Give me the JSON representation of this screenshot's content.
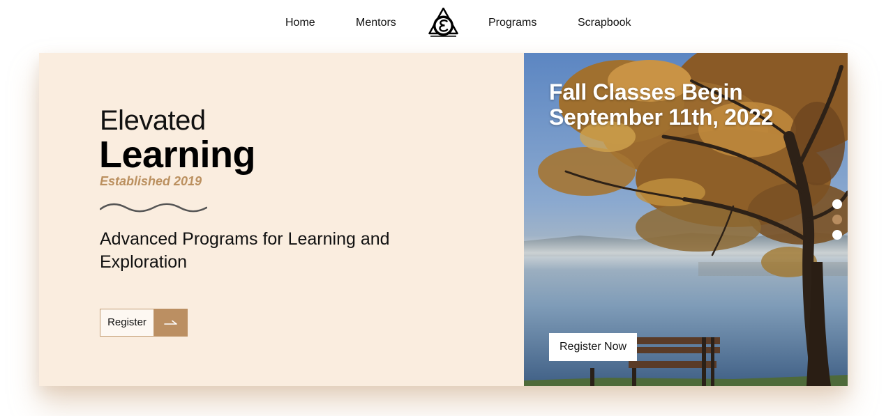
{
  "nav": {
    "items": [
      {
        "label": "Home"
      },
      {
        "label": "Mentors"
      },
      {
        "label": "Programs"
      },
      {
        "label": "Scrapbook"
      }
    ],
    "logo_icon": "triangle-epsilon-logo-icon"
  },
  "hero": {
    "brand_top": "Elevated",
    "brand_main": "Learning",
    "established": "Established 2019",
    "tagline": "Advanced Programs for Learning and Exploration",
    "register_label": "Register",
    "register_icon": "arrow-right-icon",
    "accent_color": "#bb8f62",
    "background_color": "#faeddf"
  },
  "slide": {
    "title_line1": "Fall Classes Begin",
    "title_line2": "September 11th, 2022",
    "cta_label": "Register Now",
    "active_dot": 2,
    "dot_count": 3
  }
}
